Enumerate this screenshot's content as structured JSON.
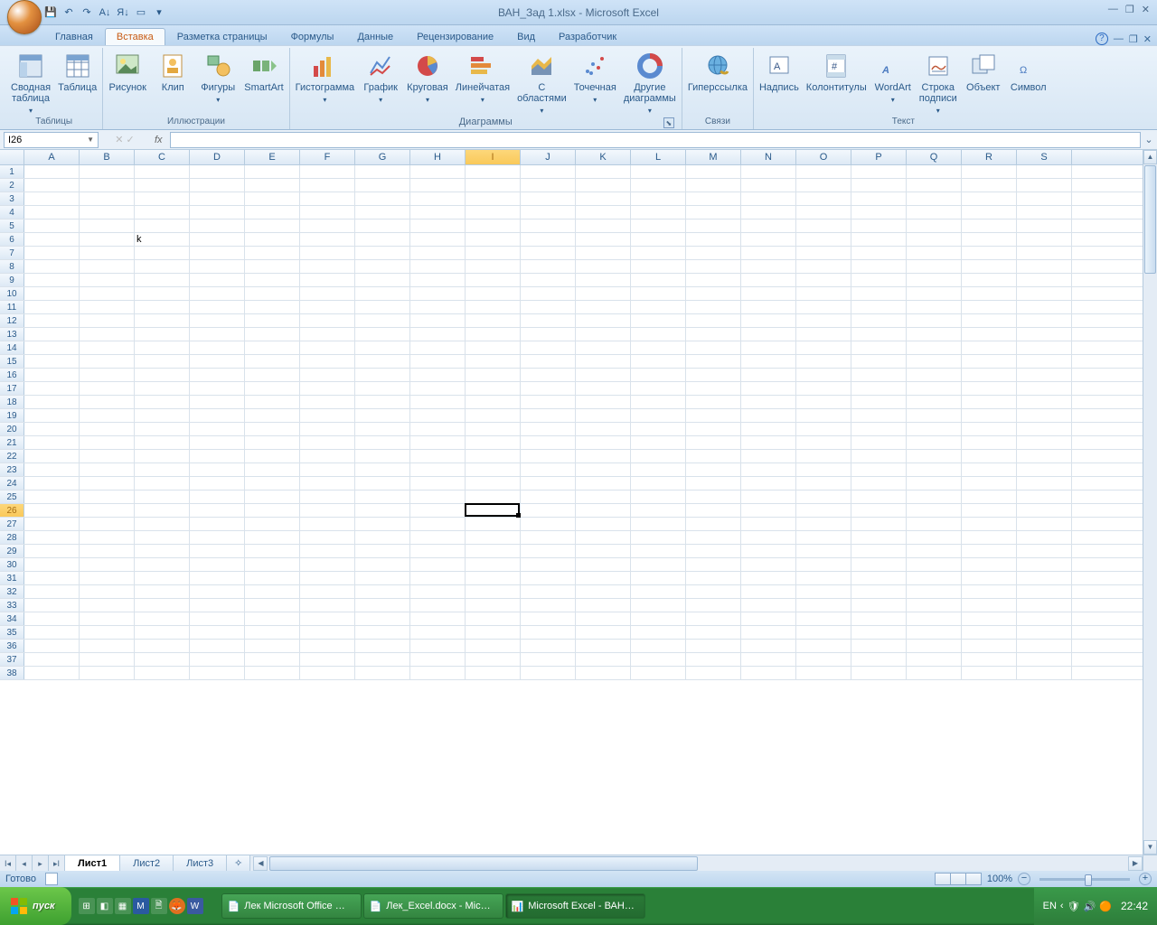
{
  "title": "ВАН_Зад 1.xlsx - Microsoft Excel",
  "qat": {
    "save": "💾",
    "undo": "↶",
    "redo": "↷",
    "sortaz": "A↓",
    "sortza": "Я↓",
    "open": "▭"
  },
  "tabs": [
    "Главная",
    "Вставка",
    "Разметка страницы",
    "Формулы",
    "Данные",
    "Рецензирование",
    "Вид",
    "Разработчик"
  ],
  "active_tab_index": 1,
  "ribbon": {
    "tables": {
      "label": "Таблицы",
      "pivot": "Сводная\nтаблица",
      "table": "Таблица"
    },
    "illus": {
      "label": "Иллюстрации",
      "picture": "Рисунок",
      "clip": "Клип",
      "shapes": "Фигуры",
      "smartart": "SmartArt"
    },
    "charts": {
      "label": "Диаграммы",
      "column": "Гистограмма",
      "line": "График",
      "pie": "Круговая",
      "bar": "Линейчатая",
      "area": "С\nобластями",
      "scatter": "Точечная",
      "other": "Другие\nдиаграммы"
    },
    "links": {
      "label": "Связи",
      "hyperlink": "Гиперссылка"
    },
    "text": {
      "label": "Текст",
      "textbox": "Надпись",
      "hf": "Колонтитулы",
      "wordart": "WordArt",
      "sigline": "Строка\nподписи",
      "object": "Объект",
      "symbol": "Символ"
    }
  },
  "namebox": "I26",
  "columns": [
    "A",
    "B",
    "C",
    "D",
    "E",
    "F",
    "G",
    "H",
    "I",
    "J",
    "K",
    "L",
    "M",
    "N",
    "O",
    "P",
    "Q",
    "R",
    "S"
  ],
  "selected_col": "I",
  "selected_row": 26,
  "row_count": 38,
  "cell_c6": "k",
  "sheets": [
    "Лист1",
    "Лист2",
    "Лист3"
  ],
  "active_sheet": 0,
  "status": "Готово",
  "zoom": "100%",
  "taskbar": {
    "start": "пуск",
    "tasks": [
      "Лек Microsoft Office …",
      "Лек_Excel.docx - Mic…",
      "Microsoft Excel - ВАН…"
    ],
    "lang": "EN",
    "time": "22:42"
  }
}
